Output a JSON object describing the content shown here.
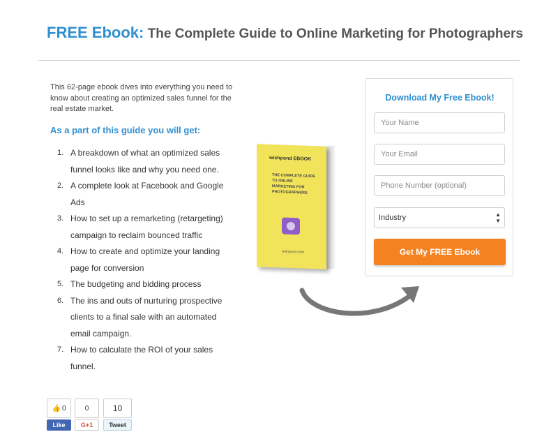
{
  "header": {
    "free_label": "FREE Ebook:",
    "title": "The Complete Guide to Online Marketing for Photographers"
  },
  "intro": {
    "text": "This 62-page ebook dives into everything you need to know about creating an optimized sales funnel for the real estate market.",
    "subhead": "As a part of this guide you will get:"
  },
  "benefits": [
    {
      "num": "1.",
      "text": "A breakdown of what an optimized sales funnel looks like and why you need one."
    },
    {
      "num": "2.",
      "text": "A complete look at Facebook and Google Ads"
    },
    {
      "num": "3.",
      "text": "How to set up a remarketing (retargeting) campaign to reclaim bounced traffic"
    },
    {
      "num": "4.",
      "text": "How to create and optimize your landing page for conversion"
    },
    {
      "num": "5.",
      "text": "The budgeting and bidding process"
    },
    {
      "num": "6.",
      "text": "The ins and outs of nurturing prospective clients to a final sale with an automated email campaign."
    },
    {
      "num": "7.",
      "text": "How to calculate the ROI of your sales funnel."
    }
  ],
  "book": {
    "brand": "wishpond EBOOK",
    "title": "THE COMPLETE GUIDE TO ONLINE MARKETING FOR PHOTOGRAPHERS",
    "url": "wishpond.com",
    "icon": "camera-badge-icon"
  },
  "form": {
    "title": "Download My Free Ebook!",
    "name_placeholder": "Your Name",
    "email_placeholder": "Your Email",
    "phone_placeholder": "Phone Number (optional)",
    "industry_value": "Industry",
    "submit_label": "Get My FREE Ebook"
  },
  "social": {
    "fb_count": "0",
    "fb_label": "Like",
    "gplus_count": "0",
    "gplus_label": "G+1",
    "tweet_count": "10",
    "tweet_label": "Tweet"
  },
  "colors": {
    "accent_blue": "#2f8fd0",
    "button_orange": "#f58220",
    "book_yellow": "#f2e45a"
  }
}
